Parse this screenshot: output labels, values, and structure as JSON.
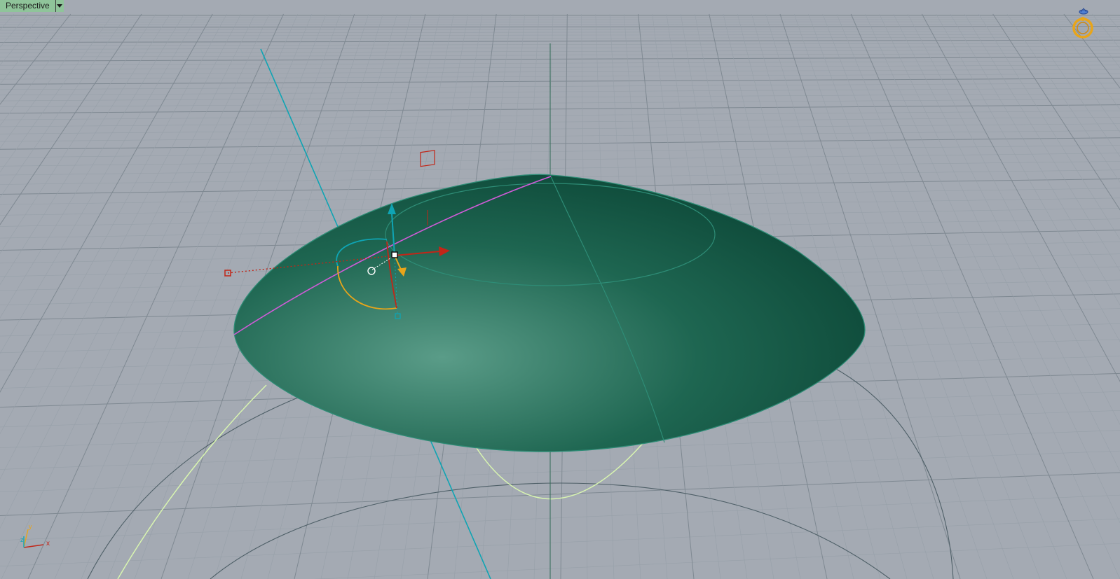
{
  "viewport": {
    "title": "Perspective",
    "menu_icon": "dropdown-triangle-icon"
  },
  "nav_widget": {
    "icon": "ring-navigation-icon"
  },
  "axis_indicator": {
    "x_label": "x",
    "y_label": "y",
    "z_label": "z"
  },
  "colors": {
    "background": "#a4aab3",
    "grid_minor": "#97a0a9",
    "grid_major": "#7f8992",
    "surface_light": "#5a9c88",
    "surface_dark": "#053a2c",
    "edge": "#2e8c76",
    "seam": "#d05bd8",
    "z_axis": "#0fa4b3",
    "x_axis": "#c22618",
    "y_axis": "#e8a51a",
    "curve": "#d8f5b0"
  }
}
